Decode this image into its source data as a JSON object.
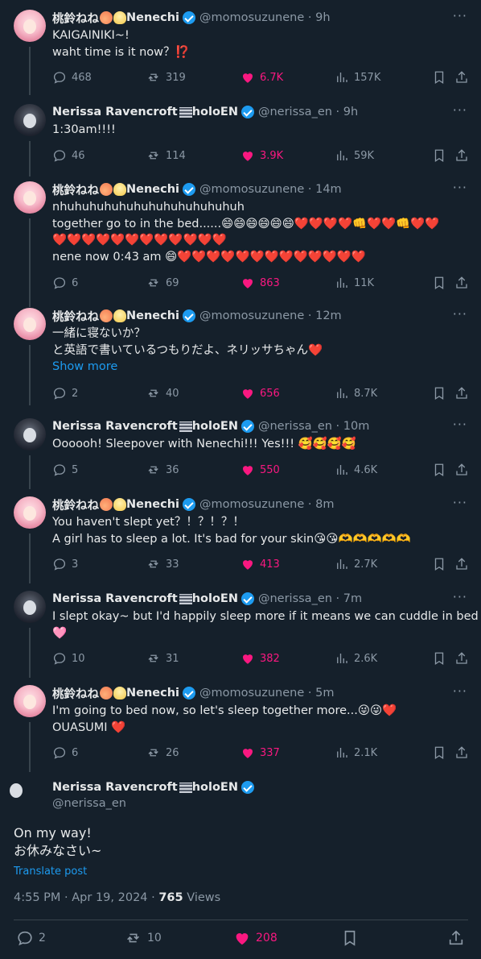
{
  "tweets": [
    {
      "author": "桃鈴ねね",
      "author_suffix": "Nenechi",
      "handle": "@momosuzunene",
      "time": "9h",
      "lines": [
        "KAIGAINIKI~!",
        "waht time is it now？⁉️"
      ],
      "replies": "468",
      "reposts": "319",
      "likes": "6.7K",
      "views": "157K"
    },
    {
      "author": "Nerissa Ravencroft",
      "author_suffix": "holoEN",
      "handle": "@nerissa_en",
      "time": "9h",
      "lines": [
        "1:30am!!!!"
      ],
      "replies": "46",
      "reposts": "114",
      "likes": "3.9K",
      "views": "59K"
    },
    {
      "author": "桃鈴ねね",
      "author_suffix": "Nenechi",
      "handle": "@momosuzunene",
      "time": "14m",
      "lines": [
        "nhuhuhuhuhuhuhuhuhuhuhuhuh",
        "together go to in the bed......😄😄😄😄😄😄❤️❤️❤️❤️👊❤️❤️👊❤️❤️",
        "❤️❤️❤️❤️❤️❤️❤️❤️❤️❤️❤️❤️",
        "nene now 0:43 am 😄❤️❤️❤️❤️❤️❤️❤️❤️❤️❤️❤️❤️❤️"
      ],
      "replies": "6",
      "reposts": "69",
      "likes": "863",
      "views": "11K"
    },
    {
      "author": "桃鈴ねね",
      "author_suffix": "Nenechi",
      "handle": "@momosuzunene",
      "time": "12m",
      "lines": [
        "一緒に寝ないか？",
        "と英語で書いているつもりだよ、ネリッサちゃん❤️"
      ],
      "show_more": "Show more",
      "replies": "2",
      "reposts": "40",
      "likes": "656",
      "views": "8.7K"
    },
    {
      "author": "Nerissa Ravencroft",
      "author_suffix": "holoEN",
      "handle": "@nerissa_en",
      "time": "10m",
      "lines": [
        "Oooooh! Sleepover with Nenechi!!! Yes!!! 🥰🥰🥰🥰"
      ],
      "replies": "5",
      "reposts": "36",
      "likes": "550",
      "views": "4.6K"
    },
    {
      "author": "桃鈴ねね",
      "author_suffix": "Nenechi",
      "handle": "@momosuzunene",
      "time": "8m",
      "lines": [
        "You haven't slept yet？！？！？！",
        " A girl has to sleep a lot. It's bad for your skin😘😘🫶🫶🫶🫶🫶"
      ],
      "replies": "3",
      "reposts": "33",
      "likes": "413",
      "views": "2.7K"
    },
    {
      "author": "Nerissa Ravencroft",
      "author_suffix": "holoEN",
      "handle": "@nerissa_en",
      "time": "7m",
      "lines": [
        "I slept okay~ but I'd happily sleep more if it means we can cuddle in bed 🖤",
        "🩷"
      ],
      "replies": "10",
      "reposts": "31",
      "likes": "382",
      "views": "2.6K"
    },
    {
      "author": "桃鈴ねね",
      "author_suffix": "Nenechi",
      "handle": "@momosuzunene",
      "time": "5m",
      "lines": [
        "I'm going to bed now, so let's sleep together more...😜😜❤️",
        "OUASUMI ❤️"
      ],
      "replies": "6",
      "reposts": "26",
      "likes": "337",
      "views": "2.1K"
    }
  ],
  "main": {
    "author": "Nerissa Ravencroft",
    "author_suffix": "holoEN",
    "handle": "@nerissa_en",
    "lines": [
      "On my way!",
      "お休みなさい~"
    ],
    "translate": "Translate post",
    "timestamp": "4:55 PM · Apr 19, 2024 · ",
    "views_count": "765",
    "views_label": " Views",
    "replies": "2",
    "reposts": "10",
    "likes": "208"
  }
}
